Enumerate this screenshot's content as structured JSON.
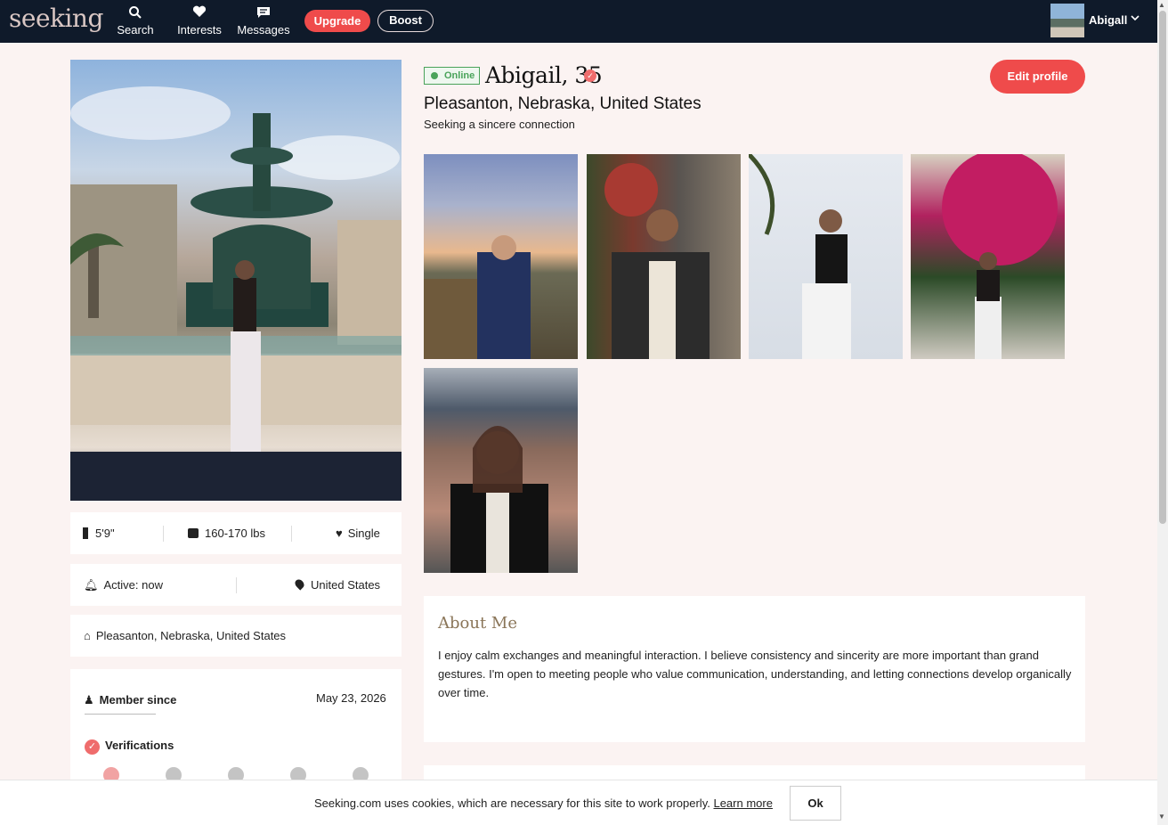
{
  "nav": {
    "logo": "seeking",
    "items": [
      {
        "label": "Search",
        "icon": "search-icon"
      },
      {
        "label": "Interests",
        "icon": "heart-icon"
      },
      {
        "label": "Messages",
        "icon": "message-icon"
      }
    ],
    "upgrade_label": "Upgrade",
    "boost_label": "Boost",
    "user_name": "Abigall"
  },
  "profile": {
    "online_label": "Online",
    "name": "Abigail, 35",
    "location": "Pleasanton, Nebraska, United States",
    "tagline": "Seeking a sincere connection",
    "edit_label": "Edit profile"
  },
  "stats": {
    "height": "5'9\"",
    "weight": "160-170 lbs",
    "relationship": "Single",
    "active": "Active: now",
    "country": "United States",
    "hometown": "Pleasanton, Nebraska, United States",
    "member_since_label": "Member since",
    "member_since_date": "May 23, 2026",
    "verifications_label": "Verifications"
  },
  "about": {
    "title": "About Me",
    "text": "I enjoy calm exchanges and meaningful interaction. I believe consistency and sincerity are more important than grand gestures. I'm open to meeting people who value communication, understanding, and letting connections develop organically over time."
  },
  "cookie": {
    "text": "Seeking.com uses cookies, which are necessary for this site to work properly.",
    "link": "Learn more",
    "ok": "Ok"
  },
  "colors": {
    "accent": "#ef4b4b",
    "nav_bg": "#0f1a2a",
    "page_bg": "#fbf3f2",
    "online_green": "#4aa35a",
    "about_title": "#8a7558"
  }
}
